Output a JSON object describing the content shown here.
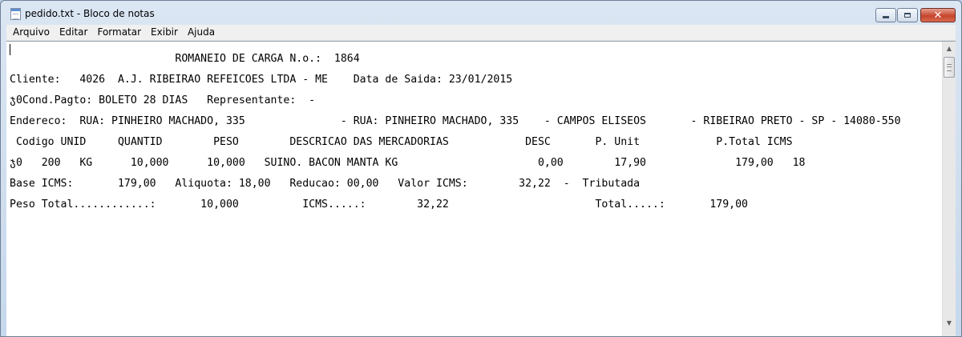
{
  "window": {
    "title": "pedido.txt - Bloco de notas",
    "icon": "notepad-icon",
    "controls": {
      "minimize": "minimize-icon",
      "maximize": "maximize-icon",
      "close": "close-icon",
      "close_glyph": "✕"
    }
  },
  "menu": {
    "items": [
      "Arquivo",
      "Editar",
      "Formatar",
      "Exibir",
      "Ajuda"
    ]
  },
  "document": {
    "lines": [
      "                          ROMANEIO DE CARGA N.o.:  1864",
      "Cliente:   4026  A.J. RIBEIRAO REFEICOES LTDA - ME    Data de Saida: 23/01/2015",
      "ჯ0Cond.Pagto: BOLETO 28 DIAS   Representante:  -",
      "Endereco:  RUA: PINHEIRO MACHADO, 335               - RUA: PINHEIRO MACHADO, 335    - CAMPOS ELISEOS       - RIBEIRAO PRETO - SP - 14080-550",
      " Codigo UNID     QUANTID        PESO        DESCRICAO DAS MERCADORIAS            DESC       P. Unit            P.Total ICMS",
      "ჯ0   200   KG      10,000      10,000   SUINO. BACON MANTA KG                      0,00        17,90              179,00   18",
      "Base ICMS:       179,00   Aliquota: 18,00   Reducao: 00,00   Valor ICMS:        32,22  -  Tributada",
      "Peso Total............:       10,000          ICMS.....:        32,22                       Total.....:       179,00"
    ]
  },
  "scrollbar": {
    "up_arrow": "▲",
    "down_arrow": "▼"
  }
}
